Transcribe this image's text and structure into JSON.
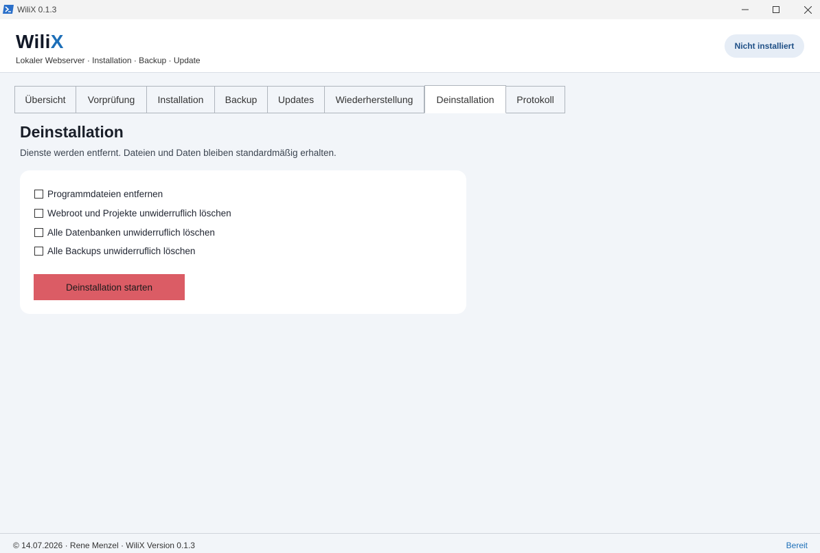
{
  "window": {
    "title": "WiliX 0.1.3",
    "app_icon": "powershell-icon"
  },
  "header": {
    "brand_prefix": "Wili",
    "brand_accent": "X",
    "tagline": "Lokaler Webserver · Installation · Backup · Update",
    "status": "Nicht installiert"
  },
  "tabs": [
    {
      "label": "Übersicht",
      "active": false
    },
    {
      "label": "Vorprüfung",
      "active": false
    },
    {
      "label": "Installation",
      "active": false
    },
    {
      "label": "Backup",
      "active": false
    },
    {
      "label": "Updates",
      "active": false
    },
    {
      "label": "Wiederherstellung",
      "active": false
    },
    {
      "label": "Deinstallation",
      "active": true
    },
    {
      "label": "Protokoll",
      "active": false
    }
  ],
  "page": {
    "title": "Deinstallation",
    "subtitle": "Dienste werden entfernt. Dateien und Daten bleiben standardmäßig erhalten."
  },
  "options": [
    {
      "label": "Programmdateien entfernen",
      "checked": false
    },
    {
      "label": "Webroot und Projekte unwiderruflich löschen",
      "checked": false
    },
    {
      "label": "Alle Datenbanken unwiderruflich löschen",
      "checked": false
    },
    {
      "label": "Alle Backups unwiderruflich löschen",
      "checked": false
    }
  ],
  "actions": {
    "start_label": "Deinstallation starten"
  },
  "footer": {
    "copyright": "© 14.07.2026 · Rene Menzel · WiliX Version 0.1.3",
    "status": "Bereit"
  },
  "colors": {
    "accent": "#1d6fb8",
    "danger": "#db5c65",
    "background": "#f2f5f9"
  }
}
